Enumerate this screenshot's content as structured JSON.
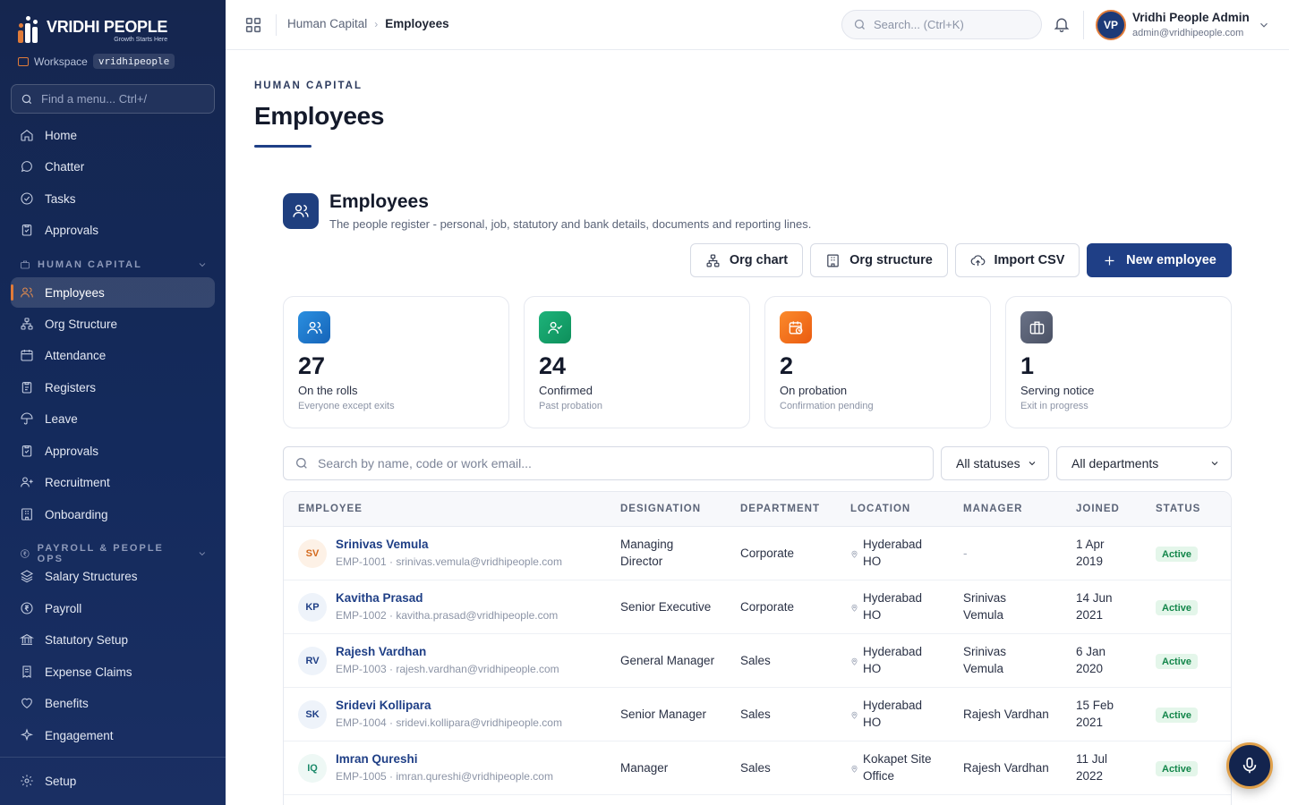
{
  "brand": {
    "name": "VRIDHI PEOPLE",
    "tagline": "Growth Starts Here"
  },
  "workspace": {
    "label": "Workspace",
    "slug": "vridhipeople"
  },
  "menu_search": {
    "placeholder": "Find a menu... Ctrl+/"
  },
  "sidebar": {
    "top_items": [
      {
        "label": "Home",
        "icon": "home-icon"
      },
      {
        "label": "Chatter",
        "icon": "chat-icon"
      },
      {
        "label": "Tasks",
        "icon": "check-circle-icon"
      },
      {
        "label": "Approvals",
        "icon": "clipboard-check-icon"
      }
    ],
    "section_human_capital": "HUMAN CAPITAL",
    "human_capital_items": [
      {
        "label": "Employees",
        "icon": "users-icon",
        "active": true
      },
      {
        "label": "Org Structure",
        "icon": "org-tree-icon"
      },
      {
        "label": "Attendance",
        "icon": "calendar-icon"
      },
      {
        "label": "Registers",
        "icon": "clipboard-icon"
      },
      {
        "label": "Leave",
        "icon": "umbrella-icon"
      },
      {
        "label": "Approvals",
        "icon": "clipboard-check-icon"
      },
      {
        "label": "Recruitment",
        "icon": "user-plus-icon"
      },
      {
        "label": "Onboarding",
        "icon": "building-icon"
      }
    ],
    "section_payroll": "PAYROLL & PEOPLE OPS",
    "payroll_items": [
      {
        "label": "Salary Structures",
        "icon": "layers-icon"
      },
      {
        "label": "Payroll",
        "icon": "rupee-circle-icon"
      },
      {
        "label": "Statutory Setup",
        "icon": "bank-icon"
      },
      {
        "label": "Expense Claims",
        "icon": "receipt-icon"
      },
      {
        "label": "Benefits",
        "icon": "heart-hand-icon"
      },
      {
        "label": "Engagement",
        "icon": "sparkle-icon"
      }
    ],
    "setup": "Setup"
  },
  "topbar": {
    "breadcrumb_parent": "Human Capital",
    "breadcrumb_current": "Employees",
    "search_placeholder": "Search... (Ctrl+K)",
    "user_initials": "VP",
    "user_name": "Vridhi People Admin",
    "user_email": "admin@vridhipeople.com"
  },
  "page": {
    "eyebrow": "HUMAN CAPITAL",
    "title": "Employees"
  },
  "section": {
    "title": "Employees",
    "subtitle": "The people register - personal, job, statutory and bank details, documents and reporting lines."
  },
  "actions": {
    "org_chart": "Org chart",
    "org_structure": "Org structure",
    "import_csv": "Import CSV",
    "new_employee": "New employee"
  },
  "stats": [
    {
      "value": "27",
      "label": "On the rolls",
      "hint": "Everyone except exits",
      "color": "#1f7fd1"
    },
    {
      "value": "24",
      "label": "Confirmed",
      "hint": "Past probation",
      "color": "#16a06a"
    },
    {
      "value": "2",
      "label": "On probation",
      "hint": "Confirmation pending",
      "color": "#f26a1b"
    },
    {
      "value": "1",
      "label": "Serving notice",
      "hint": "Exit in progress",
      "color": "#5a6275"
    }
  ],
  "filters": {
    "search_placeholder": "Search by name, code or work email...",
    "status_selected": "All statuses",
    "department_selected": "All departments"
  },
  "table": {
    "columns": [
      "EMPLOYEE",
      "DESIGNATION",
      "DEPARTMENT",
      "LOCATION",
      "MANAGER",
      "JOINED",
      "STATUS"
    ],
    "rows": [
      {
        "initials": "SV",
        "name": "Srinivas Vemula",
        "meta": "EMP-1001 · srinivas.vemula@vridhipeople.com",
        "designation": [
          "Managing",
          "Director"
        ],
        "department": "Corporate",
        "location": [
          "Hyderabad",
          "HO"
        ],
        "manager": [
          "-"
        ],
        "joined": [
          "1 Apr",
          "2019"
        ],
        "status": "Active",
        "avatar_color": "#fdf1e6",
        "avatar_text": "#d4691c"
      },
      {
        "initials": "KP",
        "name": "Kavitha Prasad",
        "meta": "EMP-1002 · kavitha.prasad@vridhipeople.com",
        "designation": [
          "Senior Executive"
        ],
        "department": "Corporate",
        "location": [
          "Hyderabad",
          "HO"
        ],
        "manager": [
          "Srinivas",
          "Vemula"
        ],
        "joined": [
          "14 Jun",
          "2021"
        ],
        "status": "Active",
        "avatar_color": "#eef3fa",
        "avatar_text": "#1f3f86"
      },
      {
        "initials": "RV",
        "name": "Rajesh Vardhan",
        "meta": "EMP-1003 · rajesh.vardhan@vridhipeople.com",
        "designation": [
          "General Manager"
        ],
        "department": "Sales",
        "location": [
          "Hyderabad",
          "HO"
        ],
        "manager": [
          "Srinivas",
          "Vemula"
        ],
        "joined": [
          "6 Jan",
          "2020"
        ],
        "status": "Active",
        "avatar_color": "#eef3fa",
        "avatar_text": "#1f3f86"
      },
      {
        "initials": "SK",
        "name": "Sridevi Kollipara",
        "meta": "EMP-1004 · sridevi.kollipara@vridhipeople.com",
        "designation": [
          "Senior Manager"
        ],
        "department": "Sales",
        "location": [
          "Hyderabad",
          "HO"
        ],
        "manager": [
          "Rajesh Vardhan"
        ],
        "joined": [
          "15 Feb",
          "2021"
        ],
        "status": "Active",
        "avatar_color": "#eef3fa",
        "avatar_text": "#1f3f86"
      },
      {
        "initials": "IQ",
        "name": "Imran Qureshi",
        "meta": "EMP-1005 · imran.qureshi@vridhipeople.com",
        "designation": [
          "Manager"
        ],
        "department": "Sales",
        "location": [
          "Kokapet Site",
          "Office"
        ],
        "manager": [
          "Rajesh Vardhan"
        ],
        "joined": [
          "11 Jul",
          "2022"
        ],
        "status": "Active",
        "avatar_color": "#eef8f5",
        "avatar_text": "#1c8a6a"
      }
    ]
  },
  "colors": {
    "sidebar_bg": "#15264f",
    "accent": "#e07b39",
    "primary": "#1f3f86",
    "active_badge": "#13864a"
  }
}
